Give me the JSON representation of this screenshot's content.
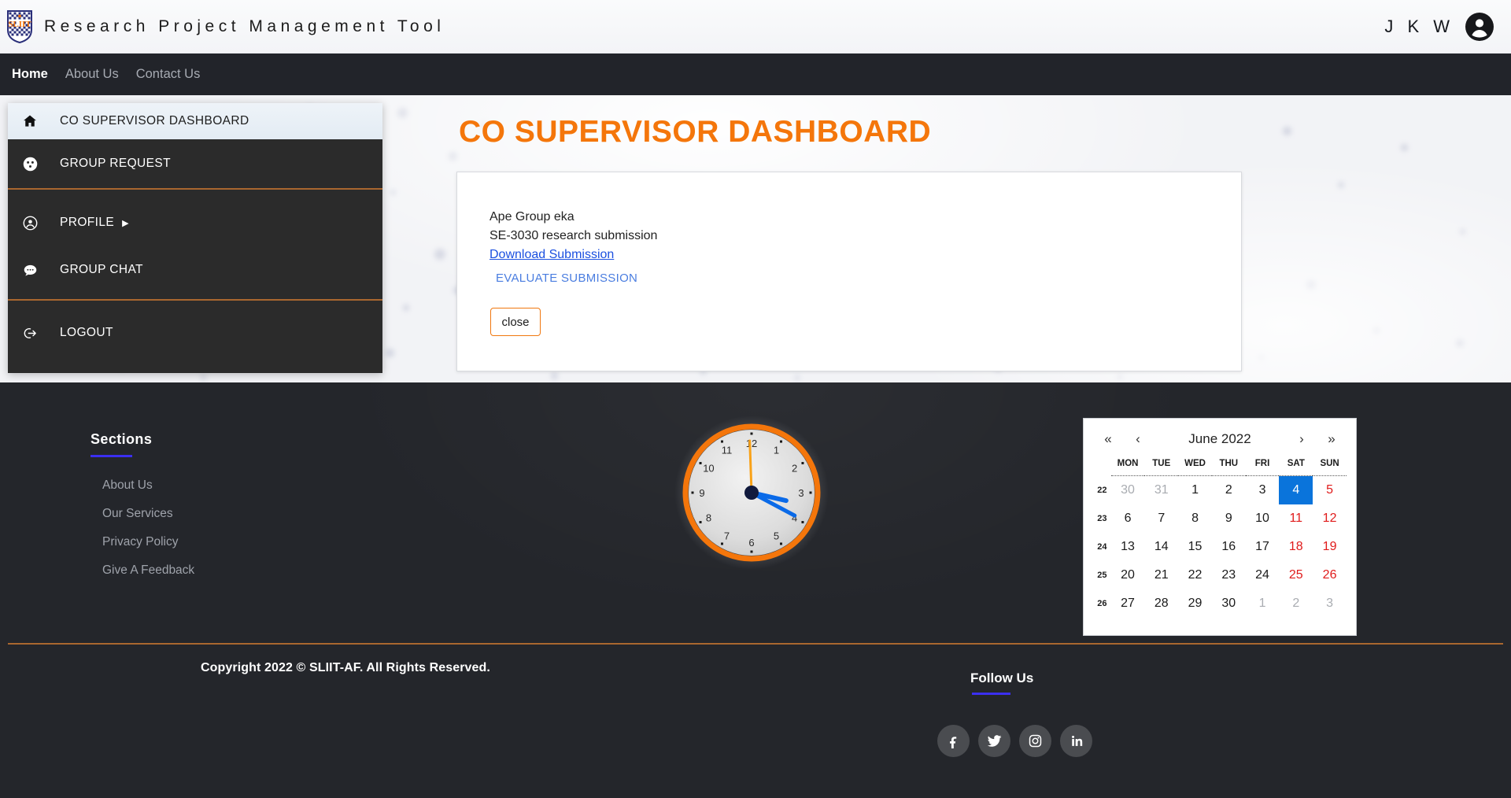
{
  "topbar": {
    "brand_title": "Research Project Management Tool",
    "logo_text": "SLIIT",
    "user_initials": "J K W",
    "avatar_icon": "account-circle-icon"
  },
  "nav": {
    "items": [
      {
        "label": "Home",
        "active": true
      },
      {
        "label": "About Us",
        "active": false
      },
      {
        "label": "Contact Us",
        "active": false
      }
    ]
  },
  "sidebar": {
    "items": [
      {
        "label": "CO SUPERVISOR DASHBOARD",
        "icon": "home-icon",
        "active": true,
        "caret": ""
      },
      {
        "label": "GROUP REQUEST",
        "icon": "group-icon",
        "active": false,
        "caret": ""
      },
      {
        "label": "PROFILE",
        "icon": "account-circle-icon",
        "active": false,
        "caret": "▶"
      },
      {
        "label": "GROUP CHAT",
        "icon": "chat-bubble-icon",
        "active": false,
        "caret": ""
      },
      {
        "label": "LOGOUT",
        "icon": "logout-icon",
        "active": false,
        "caret": ""
      }
    ]
  },
  "main": {
    "page_title": "CO SUPERVISOR DASHBOARD",
    "card": {
      "group_name": "Ape Group eka",
      "submission_title": "SE-3030 research submission",
      "download_link": "Download Submission",
      "evaluate_button": "EVALUATE SUBMISSION",
      "close_button": "close"
    }
  },
  "footer": {
    "sections": {
      "heading": "Sections",
      "links": [
        "About Us",
        "Our Services",
        "Privacy Policy",
        "Give A Feedback"
      ]
    },
    "clock": {
      "numbers": [
        "12",
        "1",
        "2",
        "3",
        "4",
        "5",
        "6",
        "7",
        "8",
        "9",
        "10",
        "11"
      ],
      "hour_angle": 103,
      "minute_angle": 118,
      "second_angle": 358,
      "rim_color": "#f4760b",
      "hand_color": "#0a6ae8",
      "second_color": "#f9a218"
    },
    "calendar": {
      "title": "June 2022",
      "nav": {
        "first": "«",
        "prev": "‹",
        "next": "›",
        "last": "»"
      },
      "day_headers": [
        "MON",
        "TUE",
        "WED",
        "THU",
        "FRI",
        "SAT",
        "SUN"
      ],
      "week_numbers": [
        "22",
        "23",
        "24",
        "25",
        "26"
      ],
      "weeks": [
        [
          {
            "d": "30",
            "t": "muted"
          },
          {
            "d": "31",
            "t": "muted"
          },
          {
            "d": "1",
            "t": ""
          },
          {
            "d": "2",
            "t": ""
          },
          {
            "d": "3",
            "t": ""
          },
          {
            "d": "4",
            "t": "sel"
          },
          {
            "d": "5",
            "t": "weekend"
          }
        ],
        [
          {
            "d": "6",
            "t": ""
          },
          {
            "d": "7",
            "t": ""
          },
          {
            "d": "8",
            "t": ""
          },
          {
            "d": "9",
            "t": ""
          },
          {
            "d": "10",
            "t": ""
          },
          {
            "d": "11",
            "t": "weekend"
          },
          {
            "d": "12",
            "t": "weekend"
          }
        ],
        [
          {
            "d": "13",
            "t": ""
          },
          {
            "d": "14",
            "t": ""
          },
          {
            "d": "15",
            "t": ""
          },
          {
            "d": "16",
            "t": ""
          },
          {
            "d": "17",
            "t": ""
          },
          {
            "d": "18",
            "t": "weekend"
          },
          {
            "d": "19",
            "t": "weekend"
          }
        ],
        [
          {
            "d": "20",
            "t": ""
          },
          {
            "d": "21",
            "t": ""
          },
          {
            "d": "22",
            "t": ""
          },
          {
            "d": "23",
            "t": ""
          },
          {
            "d": "24",
            "t": ""
          },
          {
            "d": "25",
            "t": "weekend"
          },
          {
            "d": "26",
            "t": "weekend"
          }
        ],
        [
          {
            "d": "27",
            "t": ""
          },
          {
            "d": "28",
            "t": ""
          },
          {
            "d": "29",
            "t": ""
          },
          {
            "d": "30",
            "t": ""
          },
          {
            "d": "1",
            "t": "muted"
          },
          {
            "d": "2",
            "t": "muted"
          },
          {
            "d": "3",
            "t": "muted"
          }
        ]
      ],
      "selected_day": "4"
    },
    "copyright": "Copyright 2022 © SLIIT-AF. All Rights Reserved.",
    "follow": {
      "heading": "Follow Us",
      "socials": [
        "facebook-icon",
        "twitter-icon",
        "instagram-icon",
        "linkedin-icon"
      ]
    }
  },
  "colors": {
    "accent_orange": "#f4760b",
    "divider_brown": "#a9672f",
    "underline_indigo": "#3b2ff0",
    "dark_bg": "#24262b",
    "sidebar_bg": "#2b2b2b",
    "link_blue": "#1a4fe0",
    "calendar_selected": "#0a74db",
    "weekend_red": "#e01b1b"
  }
}
